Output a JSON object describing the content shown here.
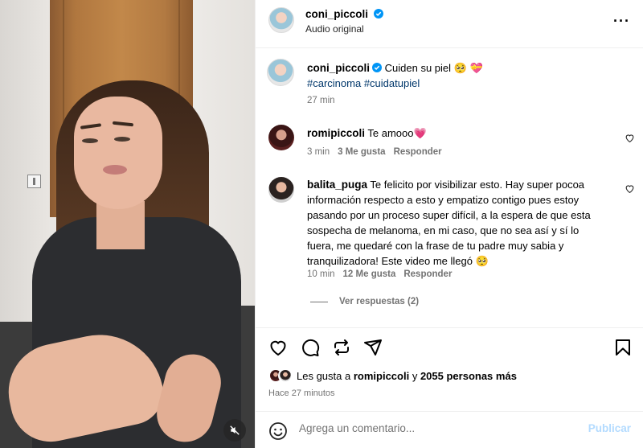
{
  "post": {
    "username": "coni_piccoli",
    "audio_label": "Audio original"
  },
  "caption": {
    "username": "coni_piccoli",
    "text": "Cuiden su piel 🥺 💝",
    "hashtags": [
      "#carcinoma",
      "#cuidatupiel"
    ],
    "time": "27 min"
  },
  "comments": [
    {
      "username": "romipiccoli",
      "text": "Te amooo💗",
      "time": "3 min",
      "likes": "3 Me gusta",
      "reply_label": "Responder"
    },
    {
      "username": "balita_puga",
      "lines": [
        "Te felicito por visibilizar esto. Hay super pocoa",
        "información respecto a esto y empatizo contigo pues estoy",
        "pasando por un proceso super difícil, a la espera de que esta",
        "sospecha de melanoma, en mi caso, que no sea así y sí lo",
        "fuera, me quedaré con la frase de tu padre muy sabia y",
        "tranquilizadora! Este video me llegó 🥺"
      ],
      "time": "10 min",
      "likes": "12 Me gusta",
      "reply_label": "Responder",
      "view_replies": "Ver respuestas (2)"
    }
  ],
  "likes_summary": {
    "prefix": "Les gusta a",
    "user": "romipiccoli",
    "joiner": "y",
    "others": "2055 personas más"
  },
  "posted_ago": "Hace 27 minutos",
  "composer": {
    "placeholder": "Agrega un comentario...",
    "submit_label": "Publicar"
  },
  "icons": {
    "verified": "verified-badge-icon",
    "more": "more-options-icon",
    "like": "heart-icon",
    "comment": "comment-icon",
    "repost": "repost-icon",
    "share": "send-icon",
    "save": "bookmark-icon",
    "emoji": "emoji-icon",
    "mute": "muted-speaker-icon"
  },
  "colors": {
    "verified": "#0095f6",
    "heart_pink": "#ff3c7a",
    "link": "#00376b",
    "muted_text": "#737373",
    "post_disabled": "#b3dbff"
  }
}
